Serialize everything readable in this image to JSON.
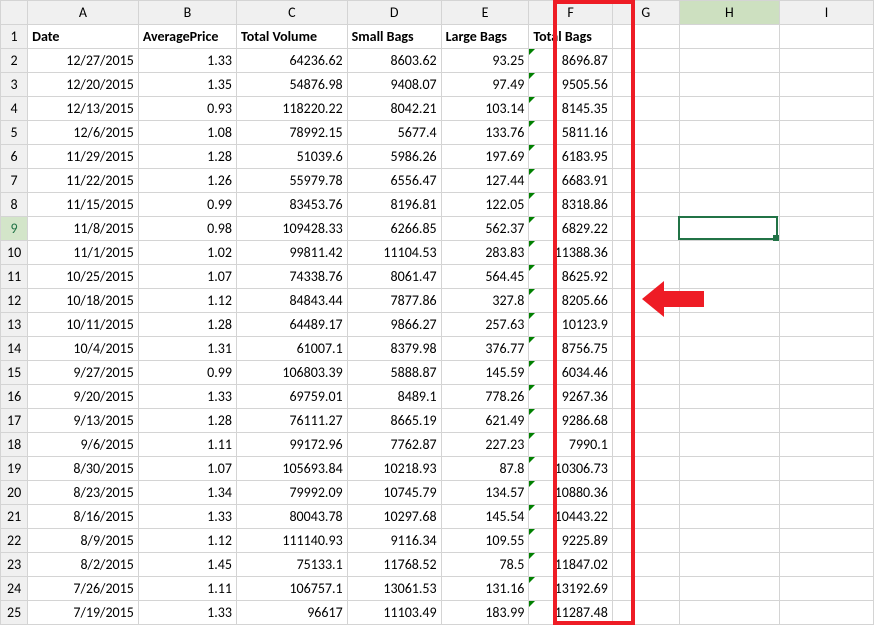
{
  "columns": [
    "A",
    "B",
    "C",
    "D",
    "E",
    "F",
    "G",
    "H",
    "I"
  ],
  "headers": {
    "A": "Date",
    "B": "AveragePrice",
    "C": "Total Volume",
    "D": "Small Bags",
    "E": "Large Bags",
    "F": "Total Bags"
  },
  "rows": [
    {
      "n": 2,
      "A": "12/27/2015",
      "B": "1.33",
      "C": "64236.62",
      "D": "8603.62",
      "E": "93.25",
      "F": "8696.87"
    },
    {
      "n": 3,
      "A": "12/20/2015",
      "B": "1.35",
      "C": "54876.98",
      "D": "9408.07",
      "E": "97.49",
      "F": "9505.56"
    },
    {
      "n": 4,
      "A": "12/13/2015",
      "B": "0.93",
      "C": "118220.22",
      "D": "8042.21",
      "E": "103.14",
      "F": "8145.35"
    },
    {
      "n": 5,
      "A": "12/6/2015",
      "B": "1.08",
      "C": "78992.15",
      "D": "5677.4",
      "E": "133.76",
      "F": "5811.16"
    },
    {
      "n": 6,
      "A": "11/29/2015",
      "B": "1.28",
      "C": "51039.6",
      "D": "5986.26",
      "E": "197.69",
      "F": "6183.95"
    },
    {
      "n": 7,
      "A": "11/22/2015",
      "B": "1.26",
      "C": "55979.78",
      "D": "6556.47",
      "E": "127.44",
      "F": "6683.91"
    },
    {
      "n": 8,
      "A": "11/15/2015",
      "B": "0.99",
      "C": "83453.76",
      "D": "8196.81",
      "E": "122.05",
      "F": "8318.86"
    },
    {
      "n": 9,
      "A": "11/8/2015",
      "B": "0.98",
      "C": "109428.33",
      "D": "6266.85",
      "E": "562.37",
      "F": "6829.22"
    },
    {
      "n": 10,
      "A": "11/1/2015",
      "B": "1.02",
      "C": "99811.42",
      "D": "11104.53",
      "E": "283.83",
      "F": "11388.36"
    },
    {
      "n": 11,
      "A": "10/25/2015",
      "B": "1.07",
      "C": "74338.76",
      "D": "8061.47",
      "E": "564.45",
      "F": "8625.92"
    },
    {
      "n": 12,
      "A": "10/18/2015",
      "B": "1.12",
      "C": "84843.44",
      "D": "7877.86",
      "E": "327.8",
      "F": "8205.66"
    },
    {
      "n": 13,
      "A": "10/11/2015",
      "B": "1.28",
      "C": "64489.17",
      "D": "9866.27",
      "E": "257.63",
      "F": "10123.9"
    },
    {
      "n": 14,
      "A": "10/4/2015",
      "B": "1.31",
      "C": "61007.1",
      "D": "8379.98",
      "E": "376.77",
      "F": "8756.75"
    },
    {
      "n": 15,
      "A": "9/27/2015",
      "B": "0.99",
      "C": "106803.39",
      "D": "5888.87",
      "E": "145.59",
      "F": "6034.46"
    },
    {
      "n": 16,
      "A": "9/20/2015",
      "B": "1.33",
      "C": "69759.01",
      "D": "8489.1",
      "E": "778.26",
      "F": "9267.36"
    },
    {
      "n": 17,
      "A": "9/13/2015",
      "B": "1.28",
      "C": "76111.27",
      "D": "8665.19",
      "E": "621.49",
      "F": "9286.68"
    },
    {
      "n": 18,
      "A": "9/6/2015",
      "B": "1.11",
      "C": "99172.96",
      "D": "7762.87",
      "E": "227.23",
      "F": "7990.1"
    },
    {
      "n": 19,
      "A": "8/30/2015",
      "B": "1.07",
      "C": "105693.84",
      "D": "10218.93",
      "E": "87.8",
      "F": "10306.73"
    },
    {
      "n": 20,
      "A": "8/23/2015",
      "B": "1.34",
      "C": "79992.09",
      "D": "10745.79",
      "E": "134.57",
      "F": "10880.36"
    },
    {
      "n": 21,
      "A": "8/16/2015",
      "B": "1.33",
      "C": "80043.78",
      "D": "10297.68",
      "E": "145.54",
      "F": "10443.22"
    },
    {
      "n": 22,
      "A": "8/9/2015",
      "B": "1.12",
      "C": "111140.93",
      "D": "9116.34",
      "E": "109.55",
      "F": "9225.89"
    },
    {
      "n": 23,
      "A": "8/2/2015",
      "B": "1.45",
      "C": "75133.1",
      "D": "11768.52",
      "E": "78.5",
      "F": "11847.02"
    },
    {
      "n": 24,
      "A": "7/26/2015",
      "B": "1.11",
      "C": "106757.1",
      "D": "13061.53",
      "E": "131.16",
      "F": "13192.69"
    },
    {
      "n": 25,
      "A": "7/19/2015",
      "B": "1.33",
      "C": "96617",
      "D": "11103.49",
      "E": "183.99",
      "F": "11287.48"
    }
  ],
  "highlight_column": "F",
  "highlight_row": 9,
  "active_cell": "H9",
  "arrow_row": 12,
  "colors": {
    "arrow": "#ee1c25",
    "box": "#ee1c25",
    "select": "#217346"
  }
}
